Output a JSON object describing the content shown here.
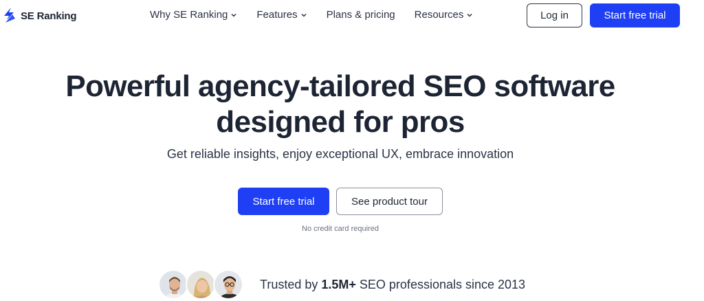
{
  "brand": {
    "name": "SE Ranking",
    "accent": "#1f3ff5"
  },
  "nav": {
    "items": [
      {
        "label": "Why SE Ranking",
        "has_dropdown": true
      },
      {
        "label": "Features",
        "has_dropdown": true
      },
      {
        "label": "Plans & pricing",
        "has_dropdown": false
      },
      {
        "label": "Resources",
        "has_dropdown": true
      }
    ],
    "login_label": "Log in",
    "trial_label": "Start free trial"
  },
  "hero": {
    "title_line1": "Powerful agency-tailored SEO software",
    "title_line2": "designed for pros",
    "subtitle": "Get reliable insights, enjoy exceptional UX, embrace innovation",
    "primary_cta": "Start free trial",
    "secondary_cta": "See product tour",
    "note": "No credit card required"
  },
  "trust": {
    "prefix": "Trusted by ",
    "highlight": "1.5M+",
    "suffix": " SEO professionals since 2013",
    "avatars": [
      "user-avatar-man-beard",
      "user-avatar-woman-blonde",
      "user-avatar-man-glasses"
    ]
  }
}
